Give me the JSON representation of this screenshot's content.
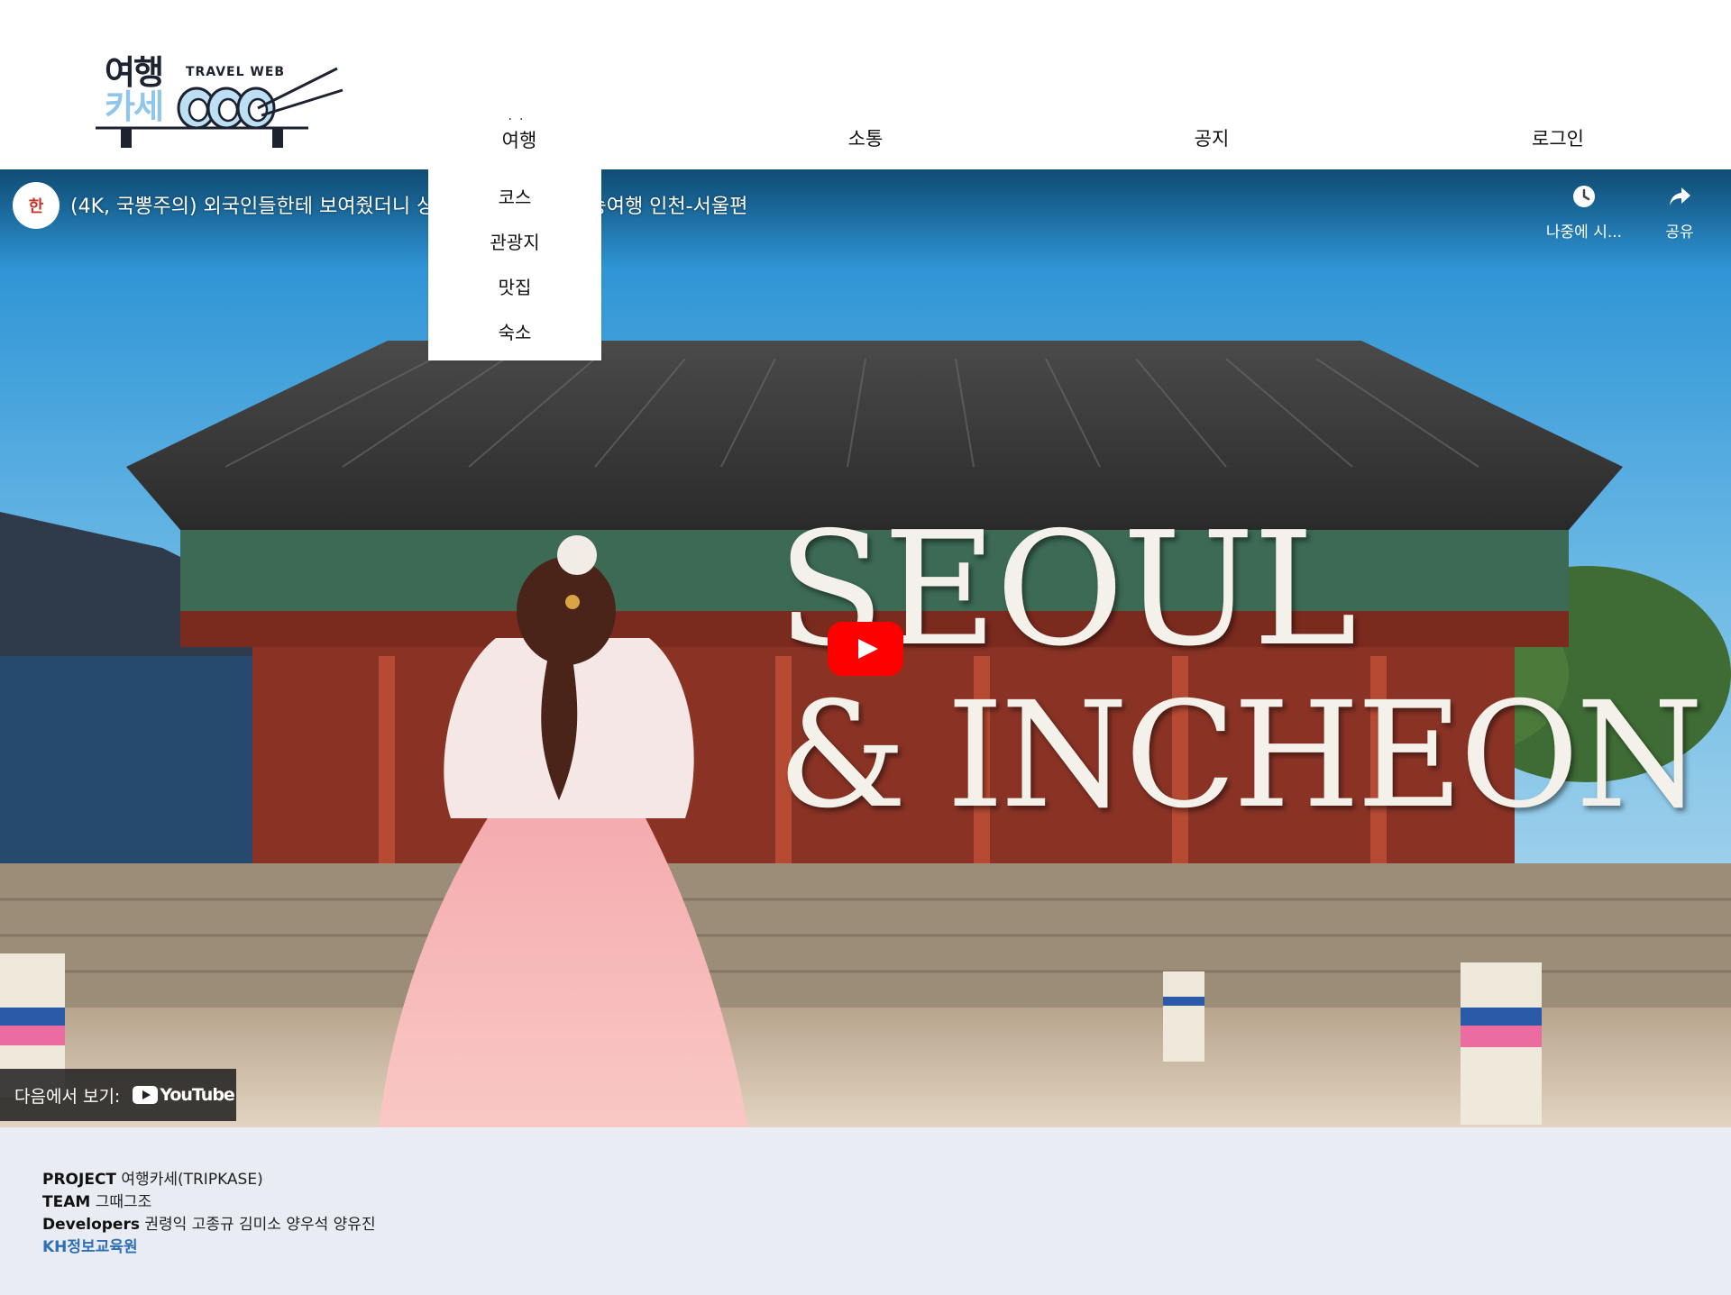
{
  "logo": {
    "title_line1": "여행",
    "title_line2": "카세",
    "subtitle": "TRAVEL WEB"
  },
  "nav": {
    "items": [
      {
        "label": "여행"
      },
      {
        "label": "소통"
      },
      {
        "label": "공지"
      },
      {
        "label": "로그인"
      }
    ]
  },
  "dropdown": {
    "items": [
      {
        "label": "코스"
      },
      {
        "label": "관광지"
      },
      {
        "label": "맛집"
      },
      {
        "label": "숙소"
      }
    ]
  },
  "video": {
    "channel_avatar_text": "한",
    "title": "(4K, 국뽕주의) 외국인들한테 보여줬더니                        상 | 한국관광공사 환승여행 인천-서울편",
    "watch_later_label": "나중에 시...",
    "share_label": "공유",
    "overlay_line1": "SEOUL",
    "overlay_line2": "& INCHEON",
    "watch_on_label": "다음에서 보기:",
    "youtube_label": "YouTube"
  },
  "footer": {
    "project_label": "PROJECT",
    "project_value": "여행카세(TRIPKASE)",
    "team_label": "TEAM",
    "team_value": "그때그조",
    "developers_label": "Developers",
    "developers_value": "권령익 고종규 김미소 양우석 양유진",
    "org": "KH정보교육원"
  },
  "colors": {
    "accent_red": "#ff0000",
    "logo_blue": "#8fc6ea",
    "footer_bg": "#e9ecf3",
    "org_link": "#2f6fb5"
  }
}
